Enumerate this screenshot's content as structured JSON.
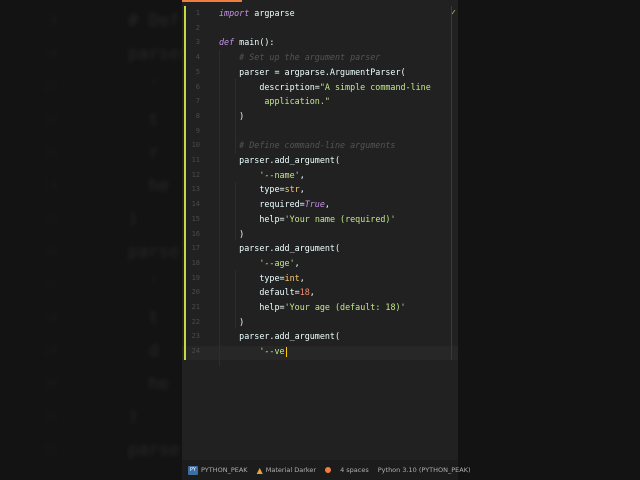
{
  "editor": {
    "lines": [
      {
        "n": "1",
        "segs": [
          {
            "t": "import",
            "c": "kw"
          },
          {
            "t": " argparse",
            "c": ""
          }
        ]
      },
      {
        "n": "2",
        "segs": []
      },
      {
        "n": "3",
        "segs": [
          {
            "t": "def",
            "c": "kw"
          },
          {
            "t": " main():",
            "c": ""
          }
        ]
      },
      {
        "n": "4",
        "segs": [
          {
            "t": "    # Set up the argument parser",
            "c": "cm"
          }
        ]
      },
      {
        "n": "5",
        "segs": [
          {
            "t": "    parser = argparse.ArgumentParser(",
            "c": ""
          }
        ]
      },
      {
        "n": "6",
        "segs": [
          {
            "t": "        description=",
            "c": ""
          },
          {
            "t": "\"A simple command-line",
            "c": "st"
          }
        ]
      },
      {
        "n": "7",
        "segs": [
          {
            "t": "         application.\"",
            "c": "st"
          }
        ]
      },
      {
        "n": "8",
        "segs": [
          {
            "t": "    )",
            "c": ""
          }
        ]
      },
      {
        "n": "9",
        "segs": []
      },
      {
        "n": "10",
        "segs": [
          {
            "t": "    # Define command-line arguments",
            "c": "cm"
          }
        ]
      },
      {
        "n": "11",
        "segs": [
          {
            "t": "    parser.add_argument(",
            "c": ""
          }
        ]
      },
      {
        "n": "12",
        "segs": [
          {
            "t": "        ",
            "c": ""
          },
          {
            "t": "'--name'",
            "c": "st"
          },
          {
            "t": ",",
            "c": ""
          }
        ]
      },
      {
        "n": "13",
        "segs": [
          {
            "t": "        type=",
            "c": ""
          },
          {
            "t": "str",
            "c": "bi"
          },
          {
            "t": ",",
            "c": ""
          }
        ]
      },
      {
        "n": "14",
        "segs": [
          {
            "t": "        required=",
            "c": ""
          },
          {
            "t": "True",
            "c": "kw"
          },
          {
            "t": ",",
            "c": ""
          }
        ]
      },
      {
        "n": "15",
        "segs": [
          {
            "t": "        help=",
            "c": ""
          },
          {
            "t": "'Your name (required)'",
            "c": "st"
          }
        ]
      },
      {
        "n": "16",
        "segs": [
          {
            "t": "    )",
            "c": ""
          }
        ]
      },
      {
        "n": "17",
        "segs": [
          {
            "t": "    parser.add_argument(",
            "c": ""
          }
        ]
      },
      {
        "n": "18",
        "segs": [
          {
            "t": "        ",
            "c": ""
          },
          {
            "t": "'--age'",
            "c": "st"
          },
          {
            "t": ",",
            "c": ""
          }
        ]
      },
      {
        "n": "19",
        "segs": [
          {
            "t": "        type=",
            "c": ""
          },
          {
            "t": "int",
            "c": "bi"
          },
          {
            "t": ",",
            "c": ""
          }
        ]
      },
      {
        "n": "20",
        "segs": [
          {
            "t": "        default=",
            "c": ""
          },
          {
            "t": "18",
            "c": "nu"
          },
          {
            "t": ",",
            "c": ""
          }
        ]
      },
      {
        "n": "21",
        "segs": [
          {
            "t": "        help=",
            "c": ""
          },
          {
            "t": "'Your age (default: 18)'",
            "c": "st"
          }
        ]
      },
      {
        "n": "22",
        "segs": [
          {
            "t": "    )",
            "c": ""
          }
        ]
      },
      {
        "n": "23",
        "segs": [
          {
            "t": "    parser.add_argument(",
            "c": ""
          }
        ]
      },
      {
        "n": "24",
        "segs": [
          {
            "t": "        ",
            "c": ""
          },
          {
            "t": "'--ve",
            "c": "st"
          }
        ]
      }
    ]
  },
  "status": {
    "project_icon_text": "PY",
    "project": "PYTHON_PEAK",
    "theme": "Material Darker",
    "indent": "4 spaces",
    "interpreter": "Python 3.10 (PYTHON_PEAK)"
  },
  "background": {
    "lines": [
      {
        "n": "8",
        "code": "# Def"
      },
      {
        "n": "10",
        "code": "parser"
      },
      {
        "n": "11",
        "code": "  '"
      },
      {
        "n": "12",
        "code": "  t"
      },
      {
        "n": "13",
        "code": "  r"
      },
      {
        "n": "14",
        "code": "  he"
      },
      {
        "n": "15",
        "code": ")"
      },
      {
        "n": "16",
        "code": "parse"
      },
      {
        "n": "17",
        "code": "  '"
      },
      {
        "n": "18",
        "code": "  t"
      },
      {
        "n": "19",
        "code": "  d"
      },
      {
        "n": "20",
        "code": "  he"
      },
      {
        "n": "21",
        "code": ")"
      },
      {
        "n": "22",
        "code": "parse"
      }
    ]
  }
}
